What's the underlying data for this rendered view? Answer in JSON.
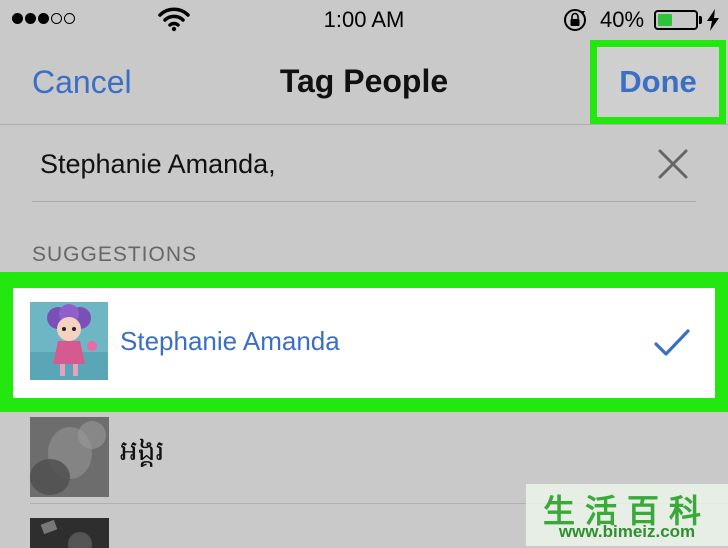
{
  "status_bar": {
    "time": "1:00 AM",
    "battery_percent": "40%",
    "battery_level": 0.4,
    "signal_bars_filled": 3,
    "signal_bars_total": 5
  },
  "nav": {
    "cancel_label": "Cancel",
    "title": "Tag People",
    "done_label": "Done"
  },
  "search": {
    "value": "Stephanie Amanda,"
  },
  "suggestions": {
    "header": "SUGGESTIONS",
    "items": [
      {
        "name": "Stephanie Amanda",
        "selected": true
      },
      {
        "name": "អង្គរ",
        "selected": false
      }
    ]
  },
  "watermark": {
    "chinese": "生活百科",
    "url": "www.bimeiz.com"
  },
  "colors": {
    "accent_blue": "#3a6fc5",
    "highlight_green": "#22e80f",
    "background_gray": "#c9c9c9",
    "battery_green": "#2ec33b"
  }
}
